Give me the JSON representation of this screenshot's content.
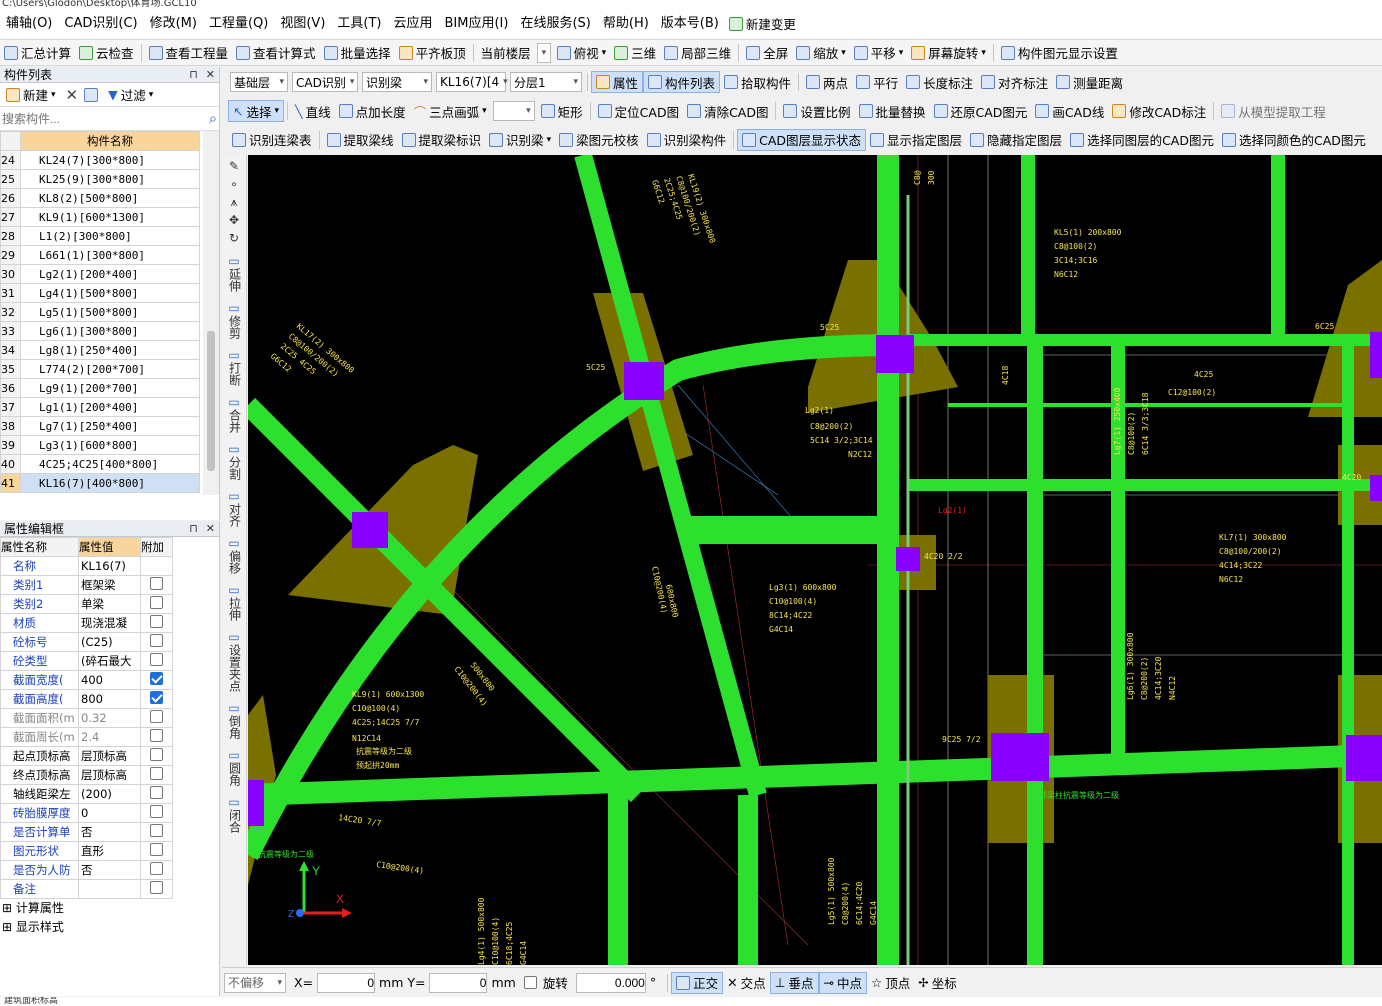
{
  "window": {
    "title": "C:\\Users\\Glodon\\Desktop\\体育场.GCL10"
  },
  "menu": [
    "辅轴(O)",
    "CAD识别(C)",
    "修改(M)",
    "工程量(Q)",
    "视图(V)",
    "工具(T)",
    "云应用",
    "BIM应用(I)",
    "在线服务(S)",
    "帮助(H)",
    "版本号(B)",
    "新建变更"
  ],
  "toolbar1": {
    "items": [
      "汇总计算",
      "云检查",
      "查看工程量",
      "查看计算式",
      "批量选择",
      "平齐板顶",
      "当前楼层",
      "俯视",
      "三维",
      "局部三维",
      "全屏",
      "缩放",
      "平移",
      "屏幕旋转",
      "构件图元显示设置"
    ]
  },
  "toolbar2": {
    "floor": "基础层",
    "cad_recog": "CAD识别",
    "recog_beam": "识别梁",
    "component": "KL16(7)[4",
    "layer": "分层1",
    "items": [
      "属性",
      "构件列表",
      "拾取构件",
      "两点",
      "平行",
      "长度标注",
      "对齐标注",
      "测量距离"
    ]
  },
  "toolbar3": {
    "items": [
      "选择",
      "直线",
      "点加长度",
      "三点画弧",
      "矩形",
      "定位CAD图",
      "清除CAD图",
      "设置比例",
      "批量替换",
      "还原CAD图元",
      "画CAD线",
      "修改CAD标注",
      "从模型提取工程"
    ]
  },
  "toolbar4": {
    "items": [
      "识别连梁表",
      "提取梁线",
      "提取梁标识",
      "识别梁",
      "梁图元校核",
      "识别梁构件",
      "CAD图层显示状态",
      "显示指定图层",
      "隐藏指定图层",
      "选择同图层的CAD图元",
      "选择同颜色的CAD图元"
    ]
  },
  "comp_list": {
    "title": "构件列表",
    "new_label": "新建",
    "filter_label": "过滤",
    "search_placeholder": "搜索构件...",
    "col_header": "构件名称",
    "rows": [
      [
        "24",
        "KL24(7)[300*800]"
      ],
      [
        "25",
        "KL25(9)[300*800]"
      ],
      [
        "26",
        "KL8(2)[500*800]"
      ],
      [
        "27",
        "KL9(1)[600*1300]"
      ],
      [
        "28",
        "L1(2)[300*800]"
      ],
      [
        "29",
        "L661(1)[300*800]"
      ],
      [
        "30",
        "Lg2(1)[200*400]"
      ],
      [
        "31",
        "Lg4(1)[500*800]"
      ],
      [
        "32",
        "Lg5(1)[500*800]"
      ],
      [
        "33",
        "Lg6(1)[300*800]"
      ],
      [
        "34",
        "Lg8(1)[250*400]"
      ],
      [
        "35",
        "L774(2)[200*700]"
      ],
      [
        "36",
        "Lg9(1)[200*700]"
      ],
      [
        "37",
        "Lg1(1)[200*400]"
      ],
      [
        "38",
        "Lg7(1)[250*400]"
      ],
      [
        "39",
        "Lg3(1)[600*800]"
      ],
      [
        "40",
        "4C25;4C25[400*800]"
      ],
      [
        "41",
        "KL16(7)[400*800]"
      ]
    ]
  },
  "prop_panel": {
    "title": "属性编辑框",
    "headers": [
      "属性名称",
      "属性值",
      "附加"
    ],
    "rows": [
      [
        "名称",
        "KL16(7)",
        ""
      ],
      [
        "类别1",
        "框架梁",
        "off"
      ],
      [
        "类别2",
        "单梁",
        "off"
      ],
      [
        "材质",
        "现浇混凝",
        "off"
      ],
      [
        "砼标号",
        "(C25)",
        "off"
      ],
      [
        "砼类型",
        "(碎石最大",
        "off"
      ],
      [
        "截面宽度(",
        "400",
        "on"
      ],
      [
        "截面高度(",
        "800",
        "on"
      ],
      [
        "截面面积(m",
        "0.32",
        "off"
      ],
      [
        "截面周长(m",
        "2.4",
        "off"
      ],
      [
        "起点顶标高",
        "层顶标高",
        "off"
      ],
      [
        "终点顶标高",
        "层顶标高",
        "off"
      ],
      [
        "轴线距梁左",
        "(200)",
        "off"
      ],
      [
        "砖胎膜厚度",
        "0",
        "off"
      ],
      [
        "是否计算单",
        "否",
        "off"
      ],
      [
        "图元形状",
        "直形",
        "off"
      ],
      [
        "是否为人防",
        "否",
        "off"
      ],
      [
        "备注",
        "",
        "off"
      ]
    ],
    "groups": [
      "计算属性",
      "显示样式"
    ]
  },
  "vtools": [
    "延伸",
    "修剪",
    "打断",
    "合并",
    "分割",
    "对齐",
    "偏移",
    "拉伸",
    "设置夹点",
    "倒角",
    "圆角",
    "闭合"
  ],
  "status": {
    "offset_mode": "不偏移",
    "x_label": "X=",
    "x_val": "0",
    "y_label": "mm Y=",
    "y_val": "0",
    "unit": "mm",
    "rotate_label": "旋转",
    "rotate_val": "0.000",
    "snap": [
      "正交",
      "交点",
      "垂点",
      "中点",
      "顶点",
      "坐标"
    ]
  },
  "bottom_text": "建筑面积标高",
  "cad_text": {
    "kl19": "KL19(2) 300x800",
    "kl19b": "C8@100/200(2)",
    "kl19c": "2C25;4C25",
    "kl19d": "G6C12",
    "kl17": "KL17(2) 300x800",
    "kl17b": "C8@100/200(2)",
    "kl17c": "2C25 4C25",
    "kl17d": "G6C12",
    "kl5": "KL5(1) 200x800",
    "kl5b": "C8@100(2)",
    "kl5c": "3C14;3C16",
    "kl5d": "N6C12",
    "c5c25": "5C25",
    "c6c25": "6C25",
    "c4c25": "4C25",
    "c12": "C12@100(2)",
    "lg2a": "Lg2(1)",
    "lg2b": "C8@200(2)",
    "lg2c": "5C14 3/2;3C14",
    "lg2d": "N2C12",
    "lg2red": "Lg2(1)",
    "lg7": "Lg7(1) 250x400",
    "lg7b": "C8@100(2)",
    "lg7c": "6C14 3/3;3C18",
    "c4c18": "4C18",
    "c4c20": "4C20",
    "kl7": "KL7(1) 300x800",
    "kl7b": "C8@100/200(2)",
    "kl7c": "4C14;3C22",
    "kl7d": "N6C12",
    "lg3": "Lg3(1) 600x800",
    "lg3b": "C10@100(4)",
    "lg3c": "8C14;4C22",
    "lg3d": "G4C14",
    "c600": "600x800",
    "c600b": "C10@200(4)",
    "kl9": "KL9(1) 600x1300",
    "kl9b": "C10@100(4)",
    "kl9c": "4C25;14C25 7/7",
    "kl9d": "N12C14",
    "kl9e": "抗震等级为二级",
    "kl9f": "预起拱20mm",
    "c500": "500x800",
    "c500b": "C10@200(4)",
    "lg6": "Lg6(1) 300x800",
    "lg6b": "C8@200(2)",
    "lg6c": "4C14;3C20",
    "lg6d": "N4C12",
    "c9c25": "9C25 7/2",
    "seis": "全部梁柱抗震等级为二级",
    "c14c20": "14C20 7/7",
    "c10": "C10@200(4)",
    "seis2": "柱抗震等级为二级",
    "lg5": "Lg5(1) 500x800",
    "lg5b": "C8@200(4)",
    "lg5c": "6C14;4C20",
    "lg5d": "G4C14",
    "lg4": "Lg4(1) 500x800",
    "lg4b": "C10@100(4)",
    "lg4c": "6C18;4C25",
    "lg4d": "G4C14",
    "c4c20b": "4C20 2/2",
    "c8a": "C8@",
    "c8b": "300"
  }
}
